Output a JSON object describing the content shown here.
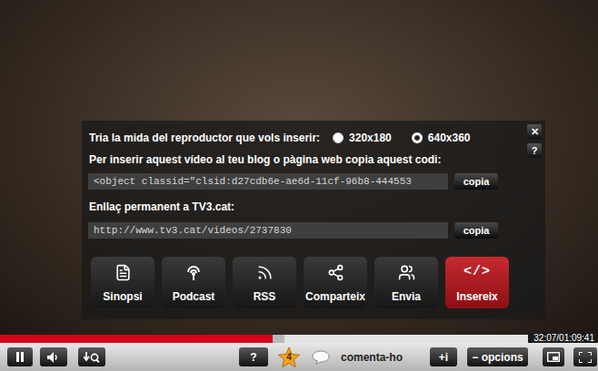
{
  "player": {
    "playing": true,
    "progress": {
      "level": 0.456,
      "buffered": 0.476
    },
    "time": "32:07/01:09:41"
  },
  "embed_panel": {
    "close": "✕",
    "help": "?",
    "size_prompt": "Tria la mida del reproductor que vols inserir:",
    "sizes": [
      {
        "label": "320x180",
        "selected": false
      },
      {
        "label": "640x360",
        "selected": true
      }
    ],
    "code_label": "Per inserir aquest vídeo al teu blog o pàgina web copia aquest codi:",
    "code_value": "<object classid=\"clsid:d27cdb6e-ae6d-11cf-96b8-444553",
    "code_copy": "copia",
    "link_label": "Enllaç permanent a TV3.cat:",
    "link_value": "http://www.tv3.cat/videos/2737830",
    "link_copy": "copia"
  },
  "tabs": [
    {
      "label": "Sinopsi",
      "selected": false
    },
    {
      "label": "Podcast",
      "selected": false
    },
    {
      "label": "RSS",
      "selected": false
    },
    {
      "label": "Comparteix",
      "selected": false
    },
    {
      "label": "Envia",
      "selected": false
    },
    {
      "label": "Insereix",
      "selected": true,
      "glyph": "</>"
    }
  ],
  "controls": {
    "help": "?",
    "rating": "4",
    "comment": "comenta-ho",
    "info": "+i",
    "options": "− opcions"
  }
}
